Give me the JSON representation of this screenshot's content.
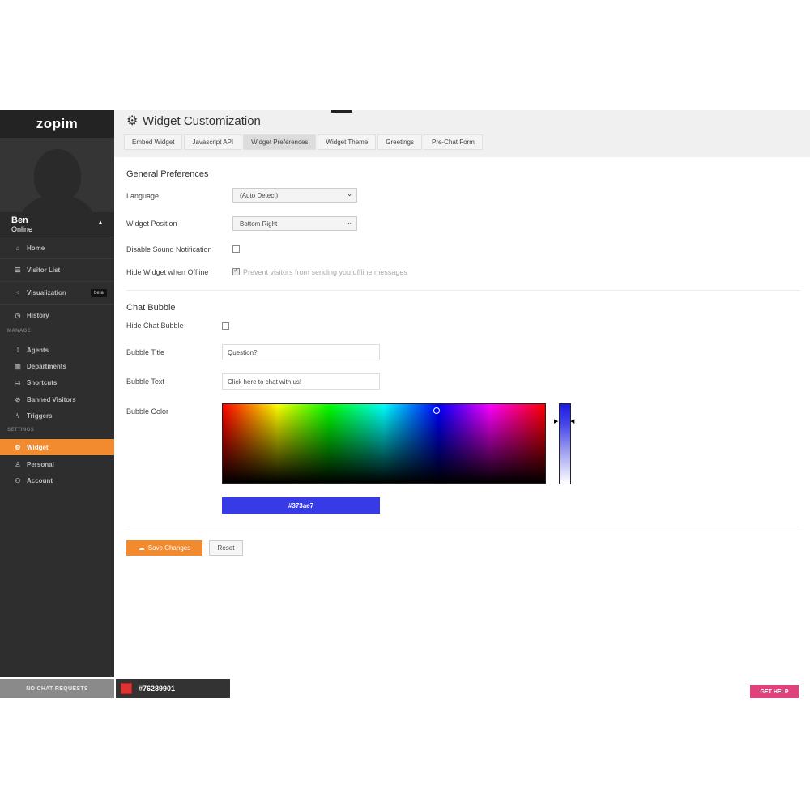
{
  "brand": "zopim",
  "user": {
    "name": "Ben",
    "status": "Online"
  },
  "sidebar": {
    "main_items": [
      {
        "label": "Home"
      },
      {
        "label": "Visitor List"
      },
      {
        "label": "Visualization",
        "badge": "beta"
      },
      {
        "label": "History"
      }
    ],
    "manage_label": "MANAGE",
    "manage_items": [
      {
        "label": "Agents"
      },
      {
        "label": "Departments"
      },
      {
        "label": "Shortcuts"
      },
      {
        "label": "Banned Visitors"
      },
      {
        "label": "Triggers"
      }
    ],
    "settings_label": "SETTINGS",
    "settings_items": [
      {
        "label": "Widget",
        "active": true
      },
      {
        "label": "Personal"
      },
      {
        "label": "Account"
      }
    ]
  },
  "header": {
    "title": "Widget Customization",
    "tabs": [
      {
        "label": "Embed Widget"
      },
      {
        "label": "Javascript API"
      },
      {
        "label": "Widget Preferences",
        "active": true
      },
      {
        "label": "Widget Theme"
      },
      {
        "label": "Greetings"
      },
      {
        "label": "Pre-Chat Form"
      }
    ]
  },
  "general": {
    "title": "General Preferences",
    "language_label": "Language",
    "language_value": "(Auto Detect)",
    "position_label": "Widget Position",
    "position_value": "Bottom Right",
    "sound_label": "Disable Sound Notification",
    "sound_checked": false,
    "offline_label": "Hide Widget when Offline",
    "offline_checked": true,
    "offline_hint": "Prevent visitors from sending you offline messages"
  },
  "bubble": {
    "title": "Chat Bubble",
    "hide_label": "Hide Chat Bubble",
    "hide_checked": false,
    "title_label": "Bubble Title",
    "title_value": "Question?",
    "text_label": "Bubble Text",
    "text_value": "Click here to chat with us!",
    "color_label": "Bubble Color",
    "color_value": "#373ae7"
  },
  "actions": {
    "save_label": "Save Changes",
    "reset_label": "Reset"
  },
  "footer": {
    "requests_label": "NO CHAT REQUESTS",
    "chat_id": "#76289901",
    "help_label": "GET HELP"
  },
  "colors": {
    "accent": "#f28b30",
    "sidebar": "#2e2e2e",
    "help": "#e0407c",
    "bubble": "#373ae7"
  }
}
